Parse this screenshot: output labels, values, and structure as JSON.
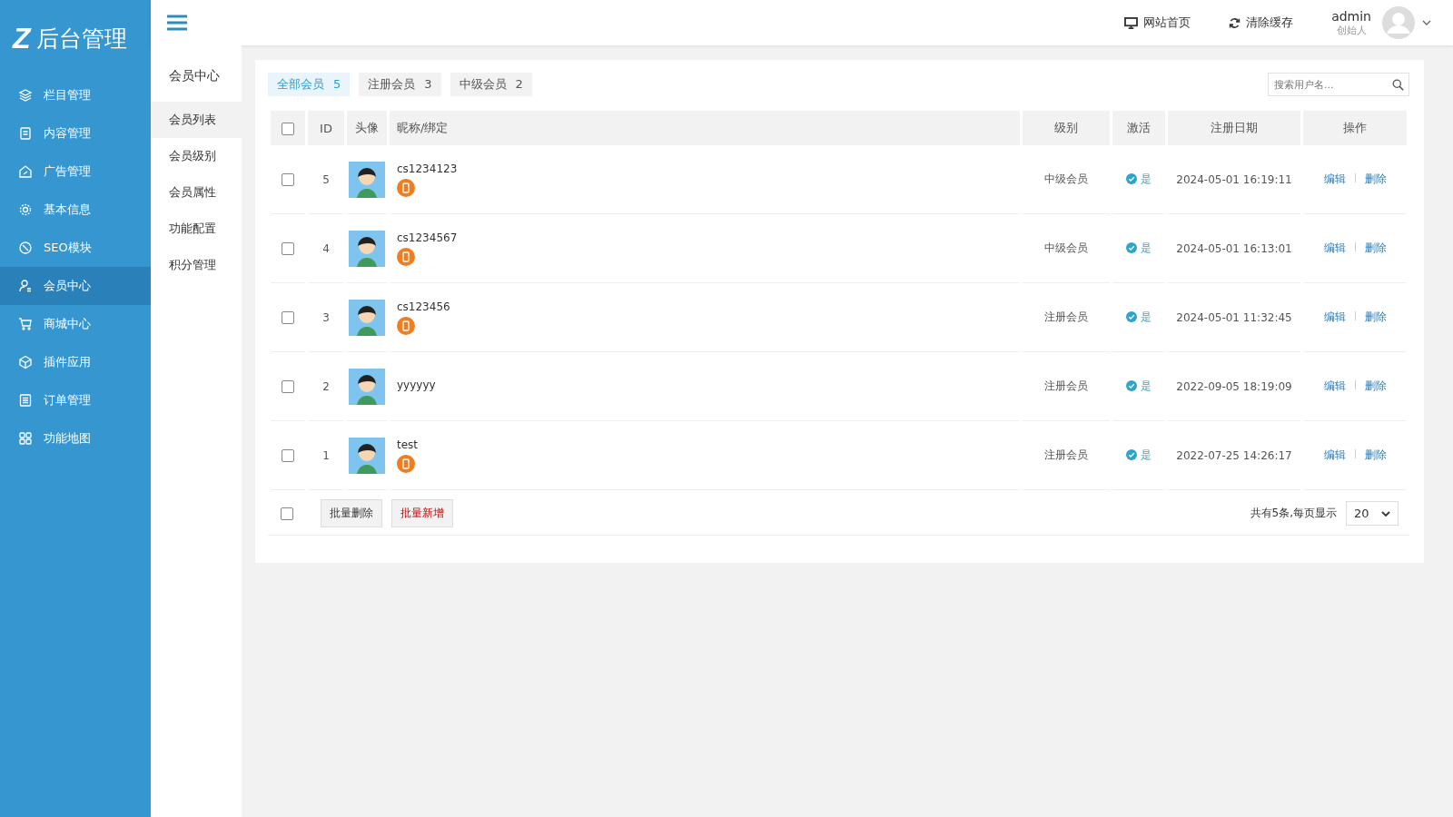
{
  "logo": {
    "mark": "Z",
    "title": "后台管理"
  },
  "sidebar": {
    "items": [
      {
        "label": "栏目管理",
        "selected": false
      },
      {
        "label": "内容管理",
        "selected": false
      },
      {
        "label": "广告管理",
        "selected": false
      },
      {
        "label": "基本信息",
        "selected": false
      },
      {
        "label": "SEO模块",
        "selected": false
      },
      {
        "label": "会员中心",
        "selected": true
      },
      {
        "label": "商城中心",
        "selected": false
      },
      {
        "label": "插件应用",
        "selected": false
      },
      {
        "label": "订单管理",
        "selected": false
      },
      {
        "label": "功能地图",
        "selected": false
      }
    ]
  },
  "topbar": {
    "links": [
      "网站首页",
      "清除缓存"
    ],
    "user": {
      "name": "admin",
      "role": "创始人"
    }
  },
  "subnav": {
    "title": "会员中心",
    "items": [
      {
        "label": "会员列表",
        "selected": true
      },
      {
        "label": "会员级别",
        "selected": false
      },
      {
        "label": "会员属性",
        "selected": false
      },
      {
        "label": "功能配置",
        "selected": false
      },
      {
        "label": "积分管理",
        "selected": false
      }
    ]
  },
  "tabs": [
    {
      "label": "全部会员",
      "count": "5",
      "selected": true
    },
    {
      "label": "注册会员",
      "count": "3",
      "selected": false
    },
    {
      "label": "中级会员",
      "count": "2",
      "selected": false
    }
  ],
  "search": {
    "placeholder": "搜索用户名..."
  },
  "table": {
    "select_all_checked": false,
    "columns": [
      "ID",
      "头像",
      "昵称/绑定",
      "级别",
      "激活",
      "注册日期",
      "操作"
    ],
    "rows": [
      {
        "checked": false,
        "id": "5",
        "name": "cs1234123",
        "phone_bound": true,
        "level": "中级会员",
        "activated": true,
        "active_label": "是",
        "date": "2024-05-01 16:19:11",
        "actions": [
          "编辑",
          "删除"
        ]
      },
      {
        "checked": false,
        "id": "4",
        "name": "cs1234567",
        "phone_bound": true,
        "level": "中级会员",
        "activated": true,
        "active_label": "是",
        "date": "2024-05-01 16:13:01",
        "actions": [
          "编辑",
          "删除"
        ]
      },
      {
        "checked": false,
        "id": "3",
        "name": "cs123456",
        "phone_bound": true,
        "level": "注册会员",
        "activated": true,
        "active_label": "是",
        "date": "2024-05-01 11:32:45",
        "actions": [
          "编辑",
          "删除"
        ]
      },
      {
        "checked": false,
        "id": "2",
        "name": "yyyyyy",
        "phone_bound": false,
        "level": "注册会员",
        "activated": true,
        "active_label": "是",
        "date": "2022-09-05 18:19:09",
        "actions": [
          "编辑",
          "删除"
        ]
      },
      {
        "checked": false,
        "id": "1",
        "name": "test",
        "phone_bound": true,
        "level": "注册会员",
        "activated": true,
        "active_label": "是",
        "date": "2022-07-25 14:26:17",
        "actions": [
          "编辑",
          "删除"
        ]
      }
    ]
  },
  "footer": {
    "select_all_checked": false,
    "buttons": [
      {
        "label": "批量删除",
        "kind": "normal"
      },
      {
        "label": "批量新增",
        "kind": "danger"
      }
    ],
    "summary": "共有5条,每页显示",
    "page_size": "20"
  }
}
